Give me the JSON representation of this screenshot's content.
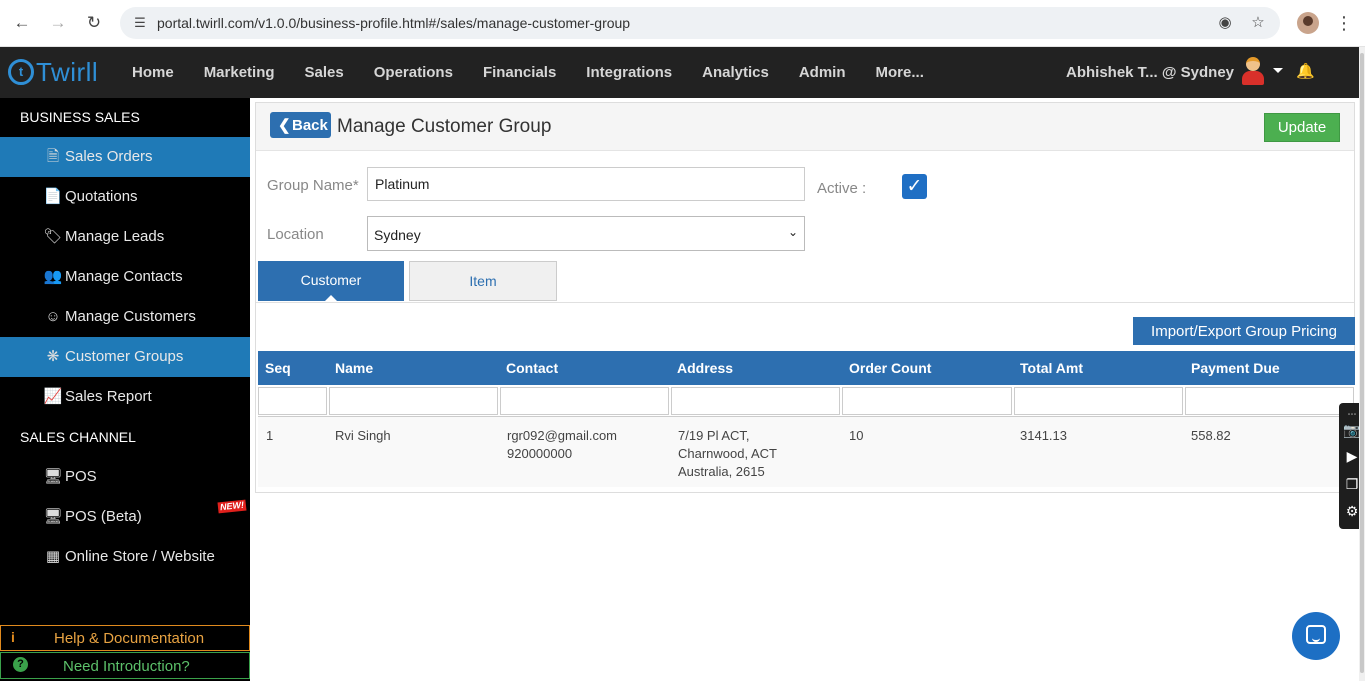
{
  "browser": {
    "url": "portal.twirll.com/v1.0.0/business-profile.html#/sales/manage-customer-group"
  },
  "navbar": {
    "logo": "Twirll",
    "menu": [
      "Home",
      "Marketing",
      "Sales",
      "Operations",
      "Financials",
      "Integrations",
      "Analytics",
      "Admin",
      "More..."
    ],
    "user": "Abhishek T... @ Sydney"
  },
  "sidebar": {
    "section1": "BUSINESS SALES",
    "items": [
      {
        "label": "Sales Orders",
        "icon": "file-icon",
        "active": true
      },
      {
        "label": "Quotations",
        "icon": "document-icon",
        "active": false
      },
      {
        "label": "Manage Leads",
        "icon": "tags-icon",
        "active": false
      },
      {
        "label": "Manage Contacts",
        "icon": "users-icon",
        "active": false
      },
      {
        "label": "Manage Customers",
        "icon": "user-circle-icon",
        "active": false
      },
      {
        "label": "Customer Groups",
        "icon": "asterisk-icon",
        "active": true
      },
      {
        "label": "Sales Report",
        "icon": "line-chart-icon",
        "active": false
      }
    ],
    "section2": "SALES CHANNEL",
    "channel_items": [
      {
        "label": "POS",
        "icon": "monitor-icon"
      },
      {
        "label": "POS (Beta)",
        "icon": "monitor-icon",
        "badge": "NEW!"
      },
      {
        "label": "Online Store / Website",
        "icon": "sitemap-icon"
      }
    ],
    "help": "Help & Documentation",
    "intro": "Need Introduction?"
  },
  "page": {
    "back_label": "Back",
    "title": "Manage Customer Group",
    "update_label": "Update",
    "group_name_label": "Group Name*",
    "group_name_value": "Platinum",
    "active_label": "Active :",
    "active": true,
    "location_label": "Location",
    "location_value": "Sydney",
    "tabs": [
      "Customer",
      "Item"
    ],
    "import_label": "Import/Export Group Pricing"
  },
  "table": {
    "columns": [
      "Seq",
      "Name",
      "Contact",
      "Address",
      "Order Count",
      "Total Amt",
      "Payment Due"
    ],
    "rows": [
      {
        "seq": "1",
        "name": "Rvi Singh",
        "contact_email": "rgr092@gmail.com",
        "contact_phone": "920000000",
        "address_line1": "7/19 Pl ACT,",
        "address_line2": "Charnwood, ACT",
        "address_line3": "Australia, 2615",
        "order_count": "10",
        "total_amt": "3141.13",
        "payment_due": "558.82"
      }
    ]
  },
  "colors": {
    "accent": "#2d6fb0",
    "sidebar_active": "#1f7ab7",
    "update": "#4caf50",
    "navbar": "#222222"
  }
}
